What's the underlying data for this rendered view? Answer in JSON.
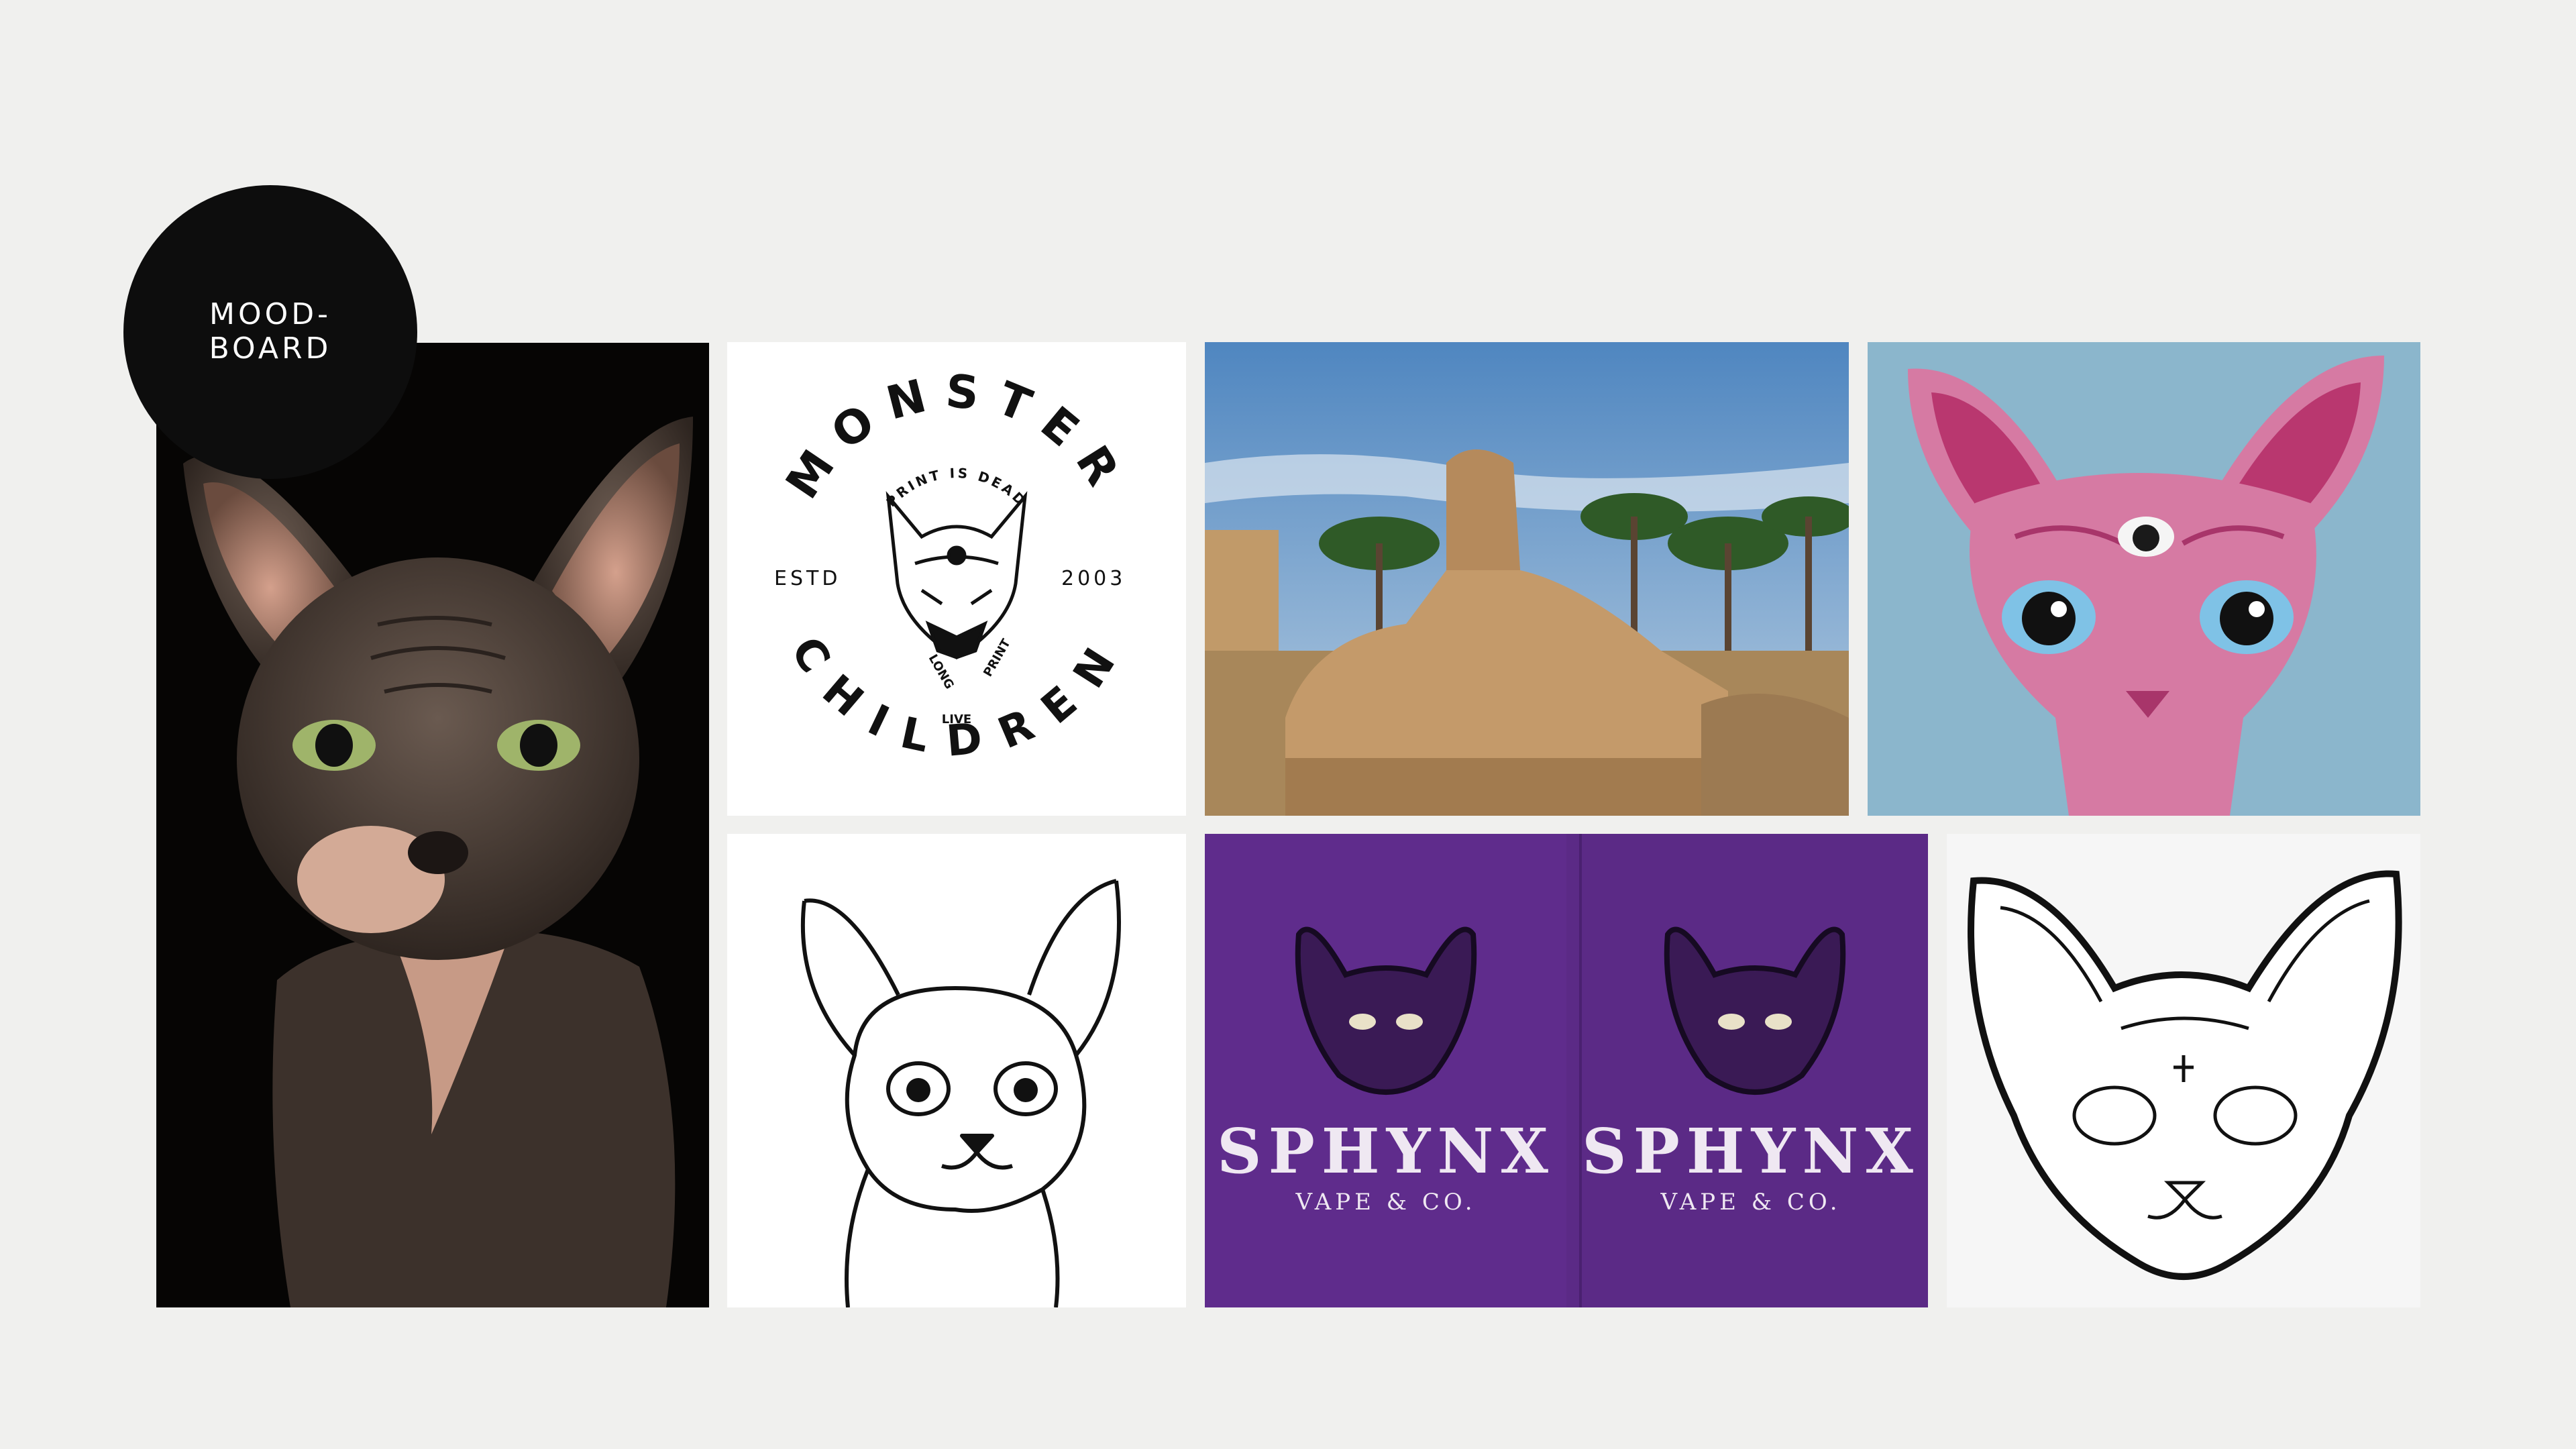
{
  "badge": {
    "line1": "MOOD-",
    "line2": "BOARD"
  },
  "monster_logo": {
    "top_word": "MONSTER",
    "bottom_word": "CHILDREN",
    "arc_text": "PRINT IS DEAD",
    "estd_label": "ESTD",
    "year": "2003",
    "left_slogan": "LONG",
    "right_slogan": "PRINT",
    "bottom_slogan": "LIVE"
  },
  "posters": {
    "brand": "SPHYNX",
    "tagline": "VAPE & CO."
  },
  "colors": {
    "background": "#f0f0ee",
    "badge": "#0d0d0d",
    "poster_purple": "#5b2a86",
    "pink_cat": "#d67aa3",
    "sky": "#8bb6cc"
  }
}
